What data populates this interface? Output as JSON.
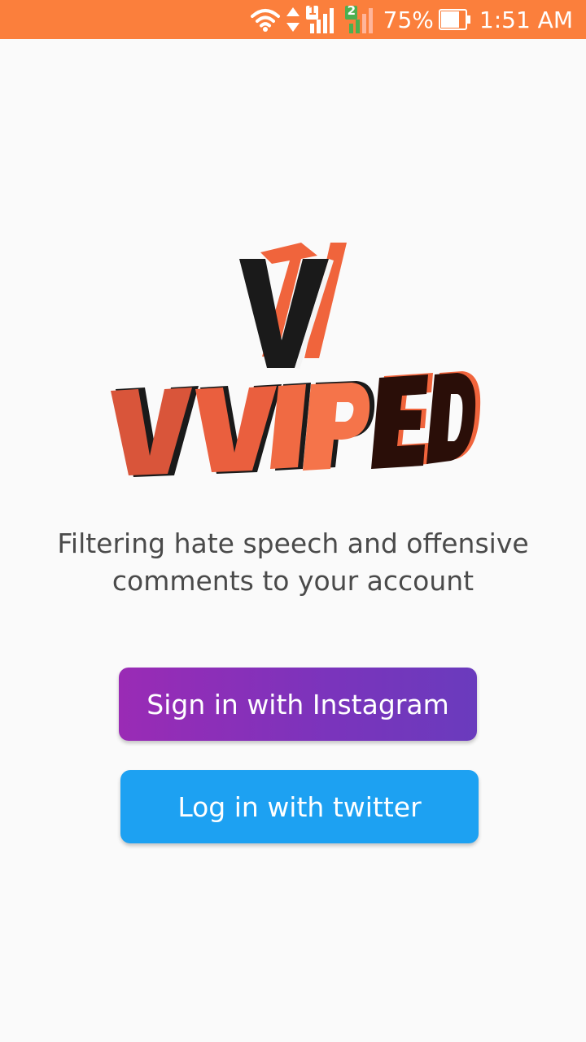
{
  "status_bar": {
    "battery_percent": "75%",
    "time": "1:51 AM",
    "sim1_label": "1",
    "sim2_label": "2",
    "icons": [
      "wifi-icon",
      "data-arrows-icon",
      "signal-sim1-icon",
      "signal-sim2-icon",
      "battery-icon"
    ]
  },
  "logo": {
    "monogram": "V",
    "wordmark": "VVIPED",
    "colors": {
      "accent": "#f0643c",
      "dark": "#1a1a1a",
      "red": "#d9553a",
      "darkbrown": "#2a0e08"
    }
  },
  "tagline": {
    "line1": "Filtering hate speech and offensive",
    "line2": "comments to your account"
  },
  "buttons": {
    "instagram_label": "Sign in with Instagram",
    "twitter_label": "Log in with twitter"
  },
  "colors": {
    "status_bar": "#fb7f3c",
    "instagram_start": "#9a2bb5",
    "instagram_end": "#6a3bbd",
    "twitter": "#1da1f2",
    "background": "#fafafa"
  }
}
